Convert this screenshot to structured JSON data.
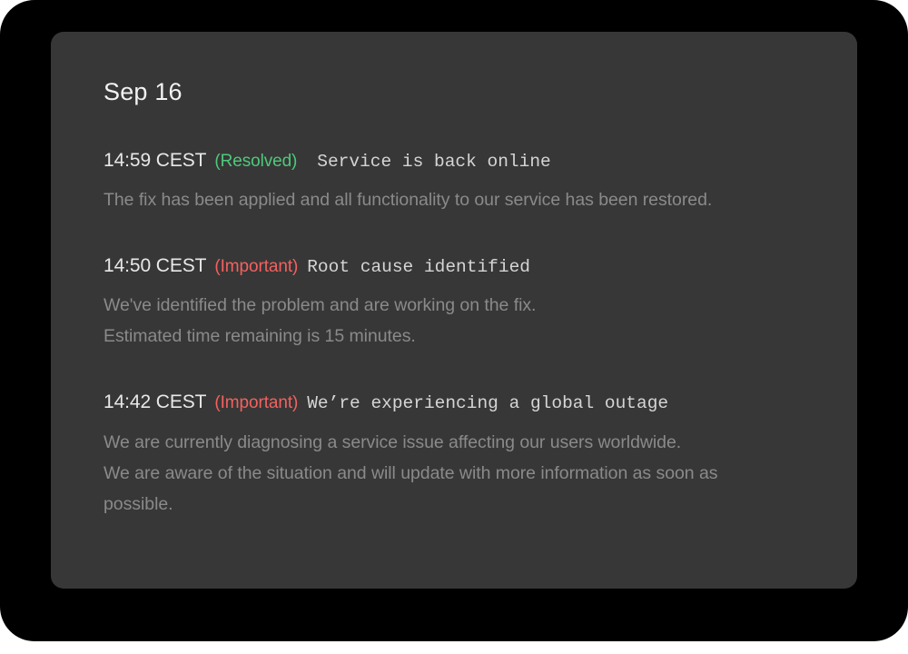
{
  "card": {
    "date_heading": "Sep 16",
    "background_color": "#373737",
    "frame_color": "#000000",
    "page_background": "#ffffff"
  },
  "colors": {
    "status_resolved": "#4ec97a",
    "status_important": "#f4615f",
    "timestamp": "#e8e8e8",
    "title": "#d5d5d5",
    "body": "#8a8a8a"
  },
  "updates": [
    {
      "time": "14:59 CEST",
      "status": "(Resolved)",
      "status_kind": "resolved",
      "title": "Service is back online",
      "body_lines": [
        "The fix has been applied and all functionality to our service has been restored."
      ]
    },
    {
      "time": "14:50 CEST",
      "status": "(Important)",
      "status_kind": "important",
      "title": "Root cause identified",
      "body_lines": [
        "We've identified the problem and are working on the fix.",
        "Estimated time remaining is 15 minutes."
      ]
    },
    {
      "time": "14:42 CEST",
      "status": "(Important)",
      "status_kind": "important",
      "title": "We’re experiencing a global outage",
      "body_lines": [
        "We are currently diagnosing a service issue affecting our users worldwide.",
        "We are aware of the situation and will update with more information as soon as",
        "possible."
      ]
    }
  ]
}
